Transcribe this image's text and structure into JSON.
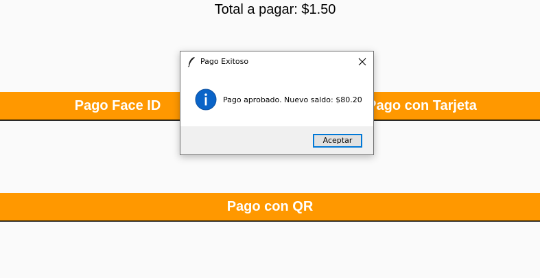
{
  "window": {
    "total_label": "Total a pagar: $1.50"
  },
  "buttons": {
    "face_id": "Pago Face ID",
    "tarjeta": "Pago con Tarjeta",
    "qr": "Pago con QR"
  },
  "dialog": {
    "title": "Pago Exitoso",
    "message": "Pago aprobado. Nuevo saldo: $80.20",
    "accept_label": "Aceptar",
    "icon": "info-icon",
    "title_icon": "feather-icon",
    "close_icon": "close-icon"
  },
  "colors": {
    "accent_orange": "#ff9800",
    "info_blue": "#0a64c8",
    "focus_blue": "#0078d7"
  }
}
